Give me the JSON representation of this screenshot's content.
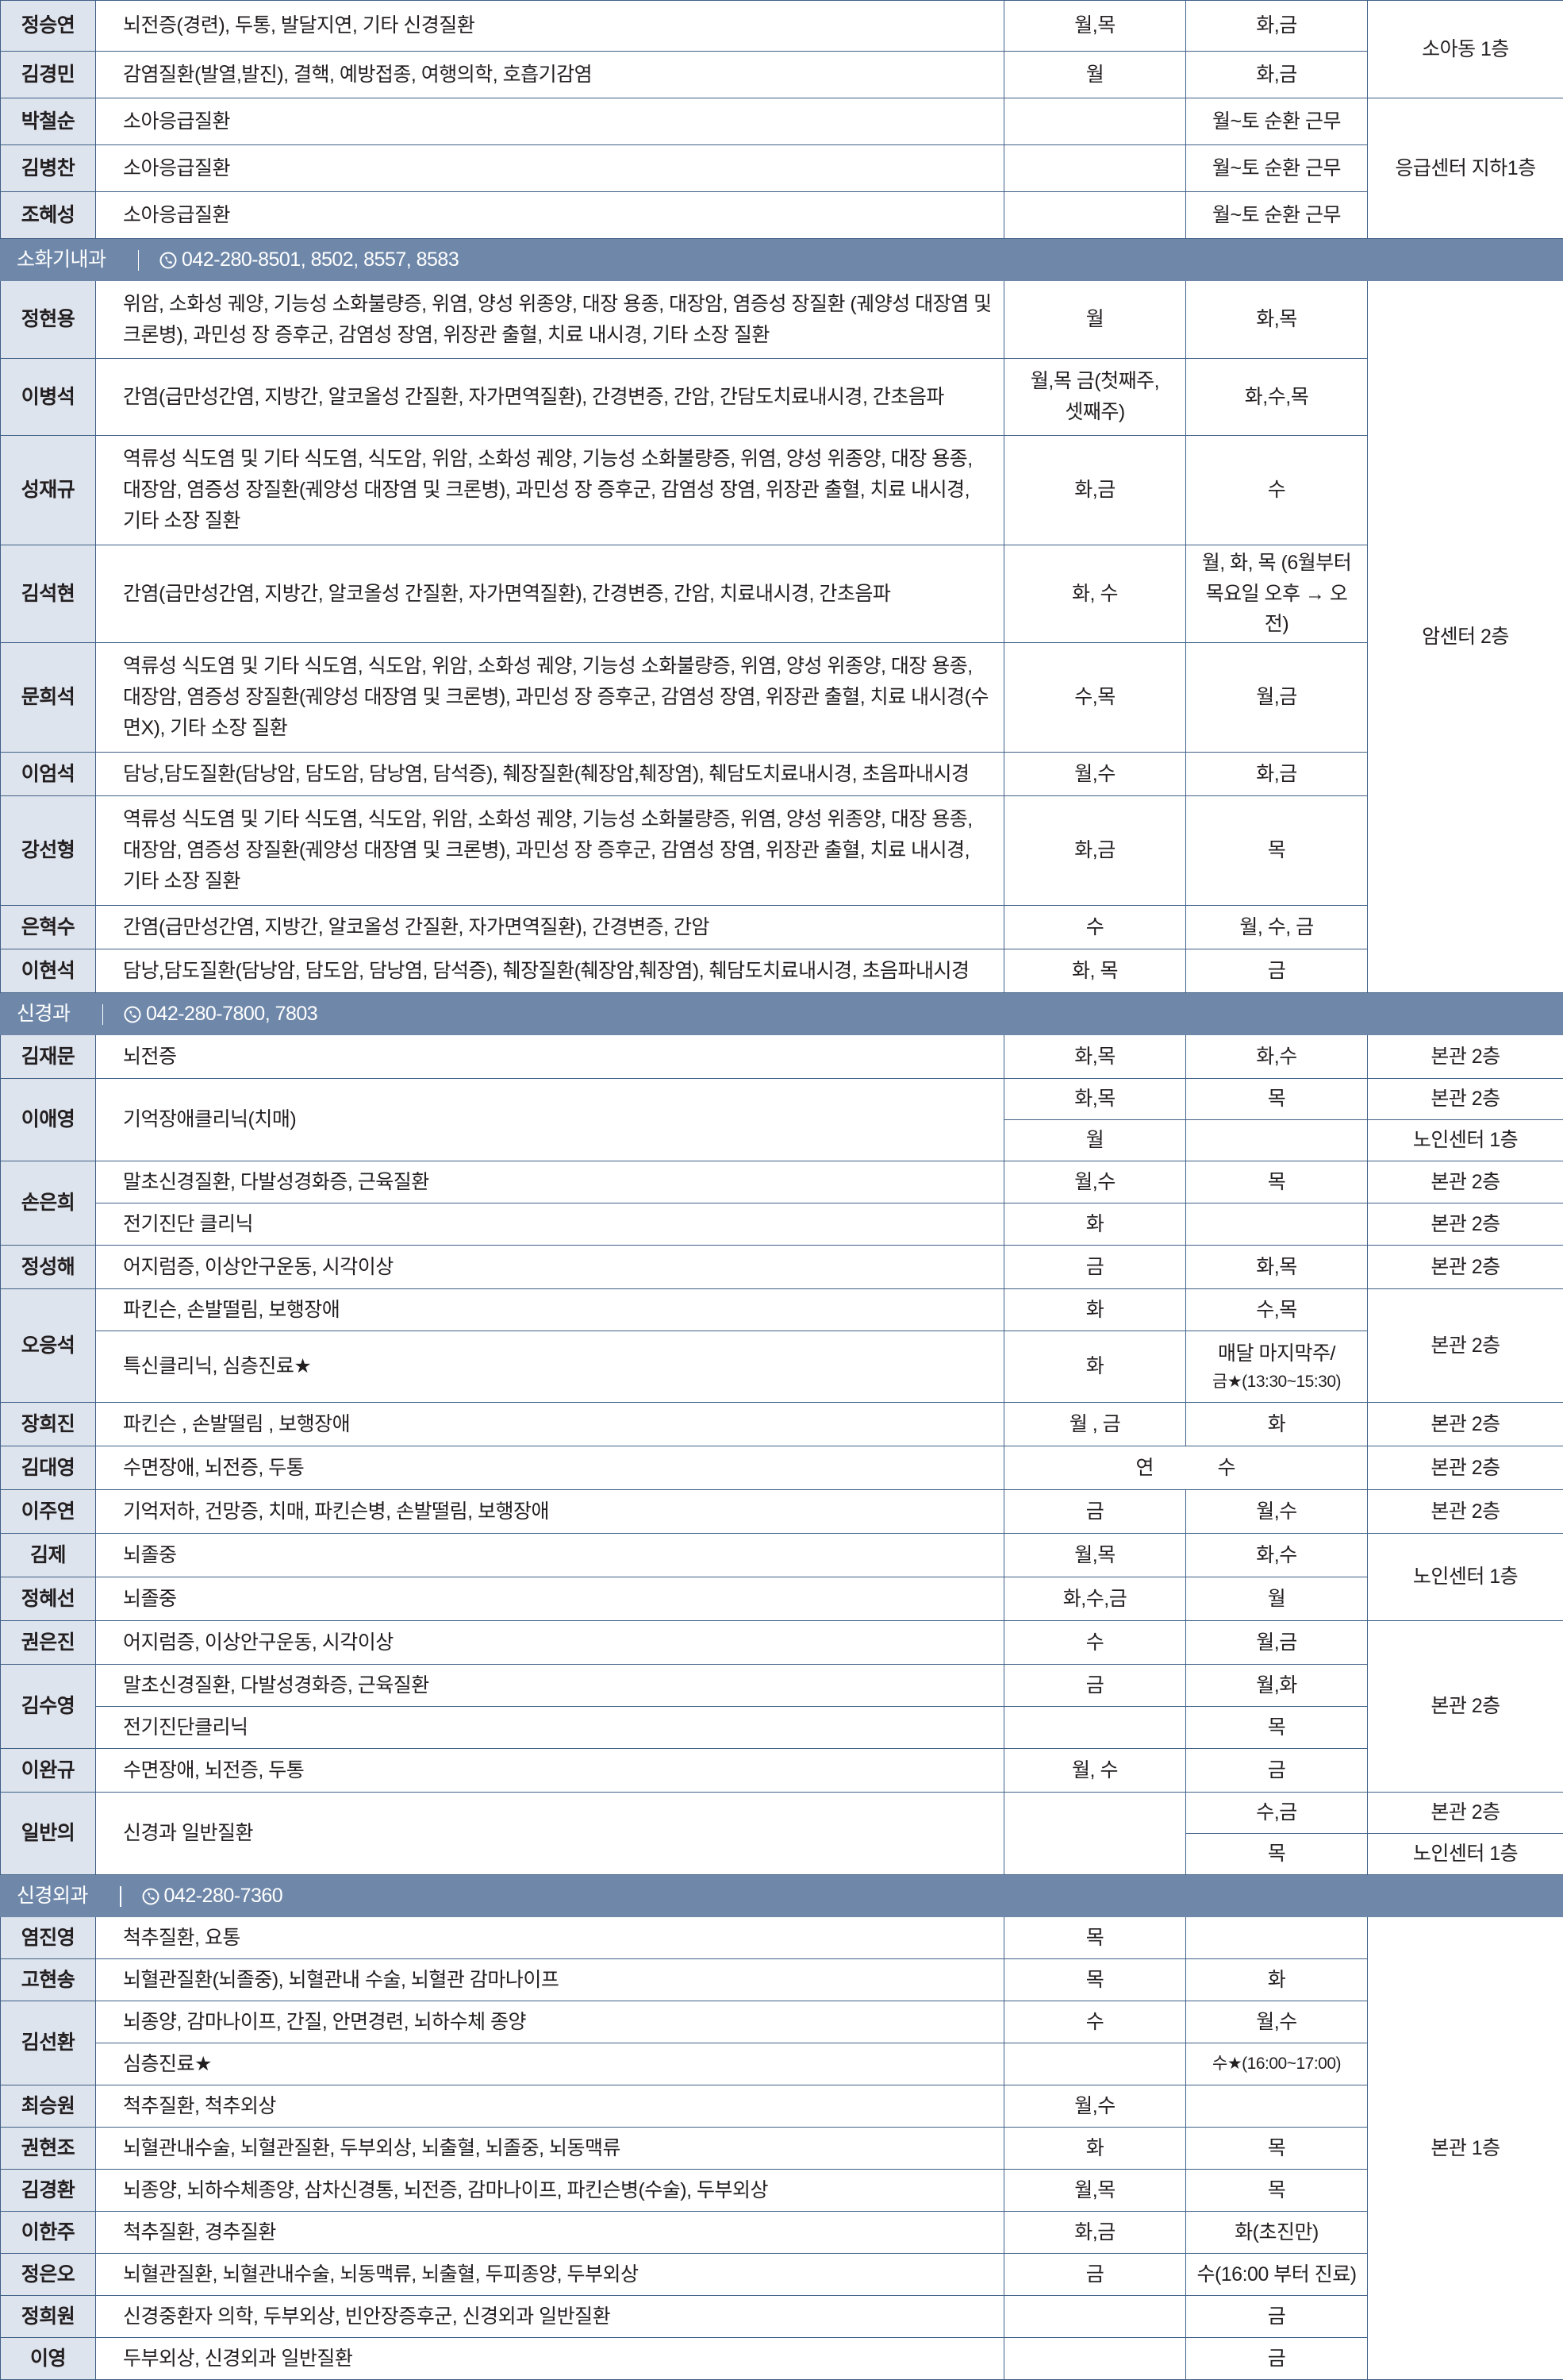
{
  "top": {
    "rows": [
      {
        "name": "정승연",
        "spec": "뇌전증(경련), 두통, 발달지연, 기타 신경질환",
        "am": "월,목",
        "pm": "화,금"
      },
      {
        "name": "김경민",
        "spec": "감염질환(발열,발진), 결핵, 예방접종, 여행의학, 호흡기감염",
        "am": "월",
        "pm": "화,금"
      },
      {
        "name": "박철순",
        "spec": "소아응급질환",
        "am": "",
        "pm": "월~토 순환 근무"
      },
      {
        "name": "김병찬",
        "spec": "소아응급질환",
        "am": "",
        "pm": "월~토 순환 근무"
      },
      {
        "name": "조혜성",
        "spec": "소아응급질환",
        "am": "",
        "pm": "월~토 순환 근무"
      }
    ],
    "loc1": "소아동 1층",
    "loc2": "응급센터 지하1층"
  },
  "gastro": {
    "title": "소화기내과",
    "phone": "042-280-8501, 8502, 8557, 8583",
    "location": "암센터 2층",
    "rows": [
      {
        "name": "정현용",
        "spec": "위암, 소화성 궤양, 기능성 소화불량증, 위염, 양성 위종양, 대장 용종, 대장암, 염증성 장질환 (궤양성 대장염 및 크론병), 과민성 장 증후군, 감염성 장염, 위장관 출혈, 치료 내시경, 기타 소장 질환",
        "am": "월",
        "pm": "화,목"
      },
      {
        "name": "이병석",
        "spec": "간염(급만성간염, 지방간, 알코올성 간질환, 자가면역질환), 간경변증, 간암, 간담도치료내시경, 간초음파",
        "am": "월,목 금(첫째주,셋째주)",
        "pm": "화,수,목"
      },
      {
        "name": "성재규",
        "spec": "역류성 식도염 및 기타 식도염, 식도암, 위암, 소화성 궤양, 기능성 소화불량증, 위염, 양성 위종양, 대장 용종, 대장암, 염증성 장질환(궤양성 대장염 및 크론병), 과민성 장 증후군, 감염성 장염, 위장관 출혈, 치료 내시경, 기타 소장 질환",
        "am": "화,금",
        "pm": "수"
      },
      {
        "name": "김석현",
        "spec": "간염(급만성간염, 지방간, 알코올성 간질환, 자가면역질환), 간경변증, 간암, 치료내시경, 간초음파",
        "am": "화, 수",
        "pm": "월, 화, 목 (6월부터 목요일 오후 → 오전)"
      },
      {
        "name": "문희석",
        "spec": "역류성 식도염 및 기타 식도염, 식도암, 위암, 소화성 궤양, 기능성 소화불량증, 위염, 양성 위종양, 대장 용종, 대장암, 염증성 장질환(궤양성 대장염 및 크론병), 과민성 장 증후군, 감염성 장염, 위장관 출혈, 치료 내시경(수면X), 기타 소장 질환",
        "am": "수,목",
        "pm": "월,금"
      },
      {
        "name": "이엄석",
        "spec": "담낭,담도질환(담낭암, 담도암, 담낭염, 담석증), 췌장질환(췌장암,췌장염), 췌담도치료내시경, 초음파내시경",
        "am": "월,수",
        "pm": "화,금"
      },
      {
        "name": "강선형",
        "spec": "역류성 식도염 및 기타 식도염, 식도암, 위암, 소화성 궤양, 기능성 소화불량증, 위염, 양성 위종양, 대장 용종, 대장암, 염증성 장질환(궤양성 대장염 및 크론병), 과민성 장 증후군, 감염성 장염, 위장관 출혈, 치료 내시경, 기타 소장 질환",
        "am": "화,금",
        "pm": "목"
      },
      {
        "name": "은혁수",
        "spec": "간염(급만성간염, 지방간, 알코올성 간질환, 자가면역질환), 간경변증, 간암",
        "am": "수",
        "pm": "월, 수, 금"
      },
      {
        "name": "이현석",
        "spec": "담낭,담도질환(담낭암, 담도암, 담낭염, 담석증), 췌장질환(췌장암,췌장염), 췌담도치료내시경, 초음파내시경",
        "am": "화, 목",
        "pm": "금"
      }
    ]
  },
  "neuro": {
    "title": "신경과",
    "phone": "042-280-7800, 7803",
    "loc_main2": "본관 2층",
    "loc_senior1": "노인센터 1층",
    "kimjaemun": {
      "name": "김재문",
      "spec": "뇌전증",
      "am": "화,목",
      "pm": "화,수",
      "loc": "본관 2층"
    },
    "leeaeyoung": {
      "name": "이애영",
      "spec": "기억장애클리닉(치매)",
      "r1": {
        "am": "화,목",
        "pm": "목",
        "loc": "본관 2층"
      },
      "r2": {
        "am": "월",
        "pm": "",
        "loc": "노인센터 1층"
      }
    },
    "soneunhee": {
      "name": "손은희",
      "r1": {
        "spec": "말초신경질환, 다발성경화증, 근육질환",
        "am": "월,수",
        "pm": "목",
        "loc": "본관 2층"
      },
      "r2": {
        "spec": "전기진단 클리닉",
        "am": "화",
        "pm": "",
        "loc": "본관 2층"
      }
    },
    "jungsunghae": {
      "name": "정성해",
      "spec": "어지럼증, 이상안구운동, 시각이상",
      "am": "금",
      "pm": "화,목",
      "loc": "본관 2층"
    },
    "ohungseok": {
      "name": "오응석",
      "r1": {
        "spec": "파킨슨, 손발떨림, 보행장애",
        "am": "화",
        "pm": "수,목"
      },
      "r2": {
        "spec": "특신클리닉, 심층진료★",
        "am": "화",
        "pm1": "매달 마지막주/",
        "pm2": "금★(13:30~15:30)"
      },
      "loc": "본관 2층"
    },
    "janghuijin": {
      "name": "장희진",
      "spec": "파킨슨 , 손발떨림 , 보행장애",
      "am": "월 , 금",
      "pm": "화",
      "loc": "본관 2층"
    },
    "kimdaeyoung": {
      "name": "김대영",
      "spec": "수면장애, 뇌전증, 두통",
      "am_pm_1": "연",
      "am_pm_2": "수",
      "loc": "본관 2층"
    },
    "leejuyeon": {
      "name": "이주연",
      "spec": "기억저하, 건망증, 치매, 파킨슨병, 손발떨림, 보행장애",
      "am": "금",
      "pm": "월,수",
      "loc": "본관 2층"
    },
    "kimje": {
      "name": "김제",
      "spec": "뇌졸중",
      "am": "월,목",
      "pm": "화,수"
    },
    "junghyesun": {
      "name": "정혜선",
      "spec": "뇌졸중",
      "am": "화,수,금",
      "pm": "월"
    },
    "kwoneunjin": {
      "name": "권은진",
      "spec": "어지럼증, 이상안구운동, 시각이상",
      "am": "수",
      "pm": "월,금"
    },
    "kimsuyoung": {
      "name": "김수영",
      "r1": {
        "spec": "말초신경질환, 다발성경화증, 근육질환",
        "am": "금",
        "pm": "월,화"
      },
      "r2": {
        "spec": "전기진단클리닉",
        "am": "",
        "pm": "목"
      }
    },
    "leewankyu": {
      "name": "이완규",
      "spec": "수면장애, 뇌전증, 두통",
      "am": "월, 수",
      "pm": "금"
    },
    "general": {
      "name": "일반의",
      "spec": "신경과 일반질환",
      "r1": {
        "pm": "수,금",
        "loc": "본관 2층"
      },
      "r2": {
        "pm": "목",
        "loc": "노인센터 1층"
      }
    }
  },
  "nsurg": {
    "title": "신경외과",
    "phone": "042-280-7360",
    "location": "본관 1층",
    "rows": [
      {
        "name": "염진영",
        "spec": "척추질환, 요통",
        "am": "목",
        "pm": ""
      },
      {
        "name": "고현송",
        "spec": "뇌혈관질환(뇌졸중), 뇌혈관내 수술, 뇌혈관 감마나이프",
        "am": "목",
        "pm": "화"
      },
      {
        "name": "최승원",
        "spec": "척추질환, 척추외상",
        "am": "월,수",
        "pm": ""
      },
      {
        "name": "권현조",
        "spec": "뇌혈관내수술, 뇌혈관질환, 두부외상, 뇌출혈, 뇌졸중, 뇌동맥류",
        "am": "화",
        "pm": "목"
      },
      {
        "name": "김경환",
        "spec": "뇌종양, 뇌하수체종양, 삼차신경통, 뇌전증, 감마나이프, 파킨슨병(수술), 두부외상",
        "am": "월,목",
        "pm": "목"
      },
      {
        "name": "이한주",
        "spec": "척추질환, 경추질환",
        "am": "화,금",
        "pm": "화(초진만)"
      },
      {
        "name": "정은오",
        "spec": "뇌혈관질환, 뇌혈관내수술, 뇌동맥류, 뇌출혈, 두피종양, 두부외상",
        "am": "금",
        "pm": "수(16:00 부터 진료)"
      },
      {
        "name": "정희원",
        "spec": "신경중환자 의학, 두부외상, 빈안장증후군, 신경외과 일반질환",
        "am": "",
        "pm": "금"
      },
      {
        "name": "이영",
        "spec": "두부외상, 신경외과 일반질환",
        "am": "",
        "pm": "금"
      }
    ],
    "kimsunhwan": {
      "name": "김선환",
      "r1": {
        "spec": "뇌종양, 감마나이프, 간질, 안면경련, 뇌하수체 종양",
        "am": "수",
        "pm": "월,수"
      },
      "r2": {
        "spec": "심층진료★",
        "am": "",
        "pm": "수★(16:00~17:00)"
      }
    }
  },
  "colors": {
    "header_bg": "#6f88aa",
    "name_bg": "#dee4ee",
    "border": "#3f5f86"
  },
  "icons": {
    "phone": "phone-icon"
  }
}
